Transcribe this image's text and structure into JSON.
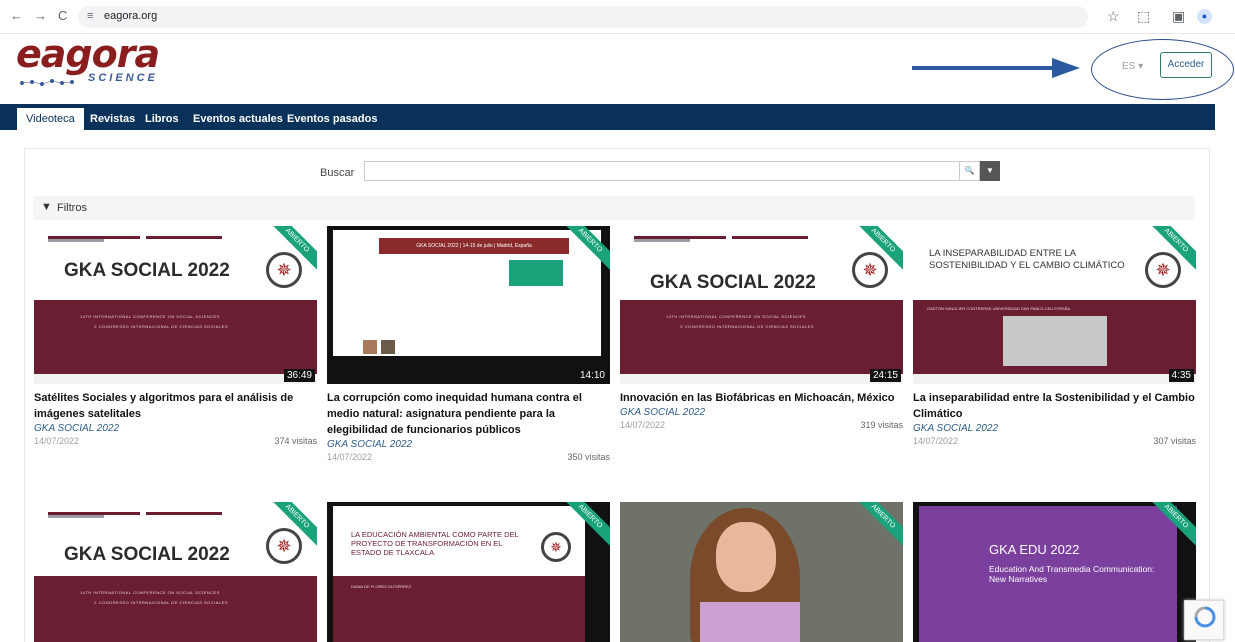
{
  "browser": {
    "url": "eagora.org",
    "back": "←",
    "forward": "→",
    "reload": "C",
    "site_icon": "≡",
    "star": "☆",
    "extensions": "⬚",
    "sidebar": "▣",
    "avatar": "●"
  },
  "header": {
    "logo_main": "eagora",
    "logo_sub": "SCIENCE",
    "language": "ES ▾",
    "login": "Acceder",
    "annotation_color": "#2c4f8a"
  },
  "nav": {
    "tabs": [
      "Videoteca",
      "Revistas",
      "Libros",
      "Eventos actuales",
      "Eventos pasados"
    ]
  },
  "search": {
    "label": "Buscar",
    "placeholder": "",
    "search_icon": "🔍",
    "filter_icon": "▼"
  },
  "filters": {
    "label": "Filtros"
  },
  "ribbon_label": "ABIERTO",
  "cards": [
    {
      "title": "Satélites Sociales y algoritmos para el análisis de imágenes satelitales",
      "event": "GKA SOCIAL 2022",
      "date": "14/07/2022",
      "visits": "374 visitas",
      "duration": "36:49",
      "thumb_title": "GKA SOCIAL 2022",
      "thumb_l1": "14TH INTERNATIONAL CONFERENCE ON SOCIAL SCIENCES",
      "thumb_l2": "X CONGRESSO INTERNACIONAL DE CIENCIAS SOCIALES"
    },
    {
      "title": "La corrupción como inequidad humana contra el medio natural: asignatura pendiente para la elegibilidad de funcionarios públicos",
      "event": "GKA SOCIAL 2022",
      "date": "14/07/2022",
      "visits": "350 visitas",
      "duration": "14:10",
      "thumb_title": "GKA SOCIAL 2022 | 14-15 de julio | Madrid, España"
    },
    {
      "title": "Innovación en las Biofábricas en Michoacán, México",
      "event": "GKA SOCIAL 2022",
      "date": "14/07/2022",
      "visits": "319 visitas",
      "duration": "24:15",
      "thumb_title": "GKA SOCIAL 2022",
      "thumb_l1": "14TH INTERNATIONAL CONFERENCE ON SOCIAL SCIENCES",
      "thumb_l2": "X CONGRESSO INTERNACIONAL DE CIENCIAS SOCIALES"
    },
    {
      "title": "La inseparabilidad entre la Sostenibilidad y el Cambio Climático",
      "event": "GKA SOCIAL 2022",
      "date": "14/07/2022",
      "visits": "307 visitas",
      "duration": "4:35",
      "thumb_title": "LA INSEPARABILIDAD ENTRE LA SOSTENIBILIDAD Y EL CAMBIO CLIMÁTICO",
      "thumb_sub": "GASTÓN SANGLIER CONTRERAS UNIVERSIDAD SAN PABLO-CEU ESPAÑA"
    },
    {
      "thumb_title": "GKA SOCIAL 2022",
      "thumb_l1": "14TH INTERNATIONAL CONFERENCE ON SOCIAL SCIENCES",
      "thumb_l2": "X CONGRESSO INTERNACIONAL DE CIENCIAS SOCIALES"
    },
    {
      "thumb_title": "LA EDUCACIÓN AMBIENTAL COMO PARTE DEL PROYECTO DE TRANSFORMACIÓN EN EL ESTADO DE TLAXCALA",
      "thumb_sub": "DIANA DE FLORES GUTIÉRREZ"
    },
    {
      "thumb_title": ""
    },
    {
      "thumb_title": "GKA EDU 2022",
      "thumb_sub": "Education And Transmedia Communication: New Narratives"
    }
  ]
}
